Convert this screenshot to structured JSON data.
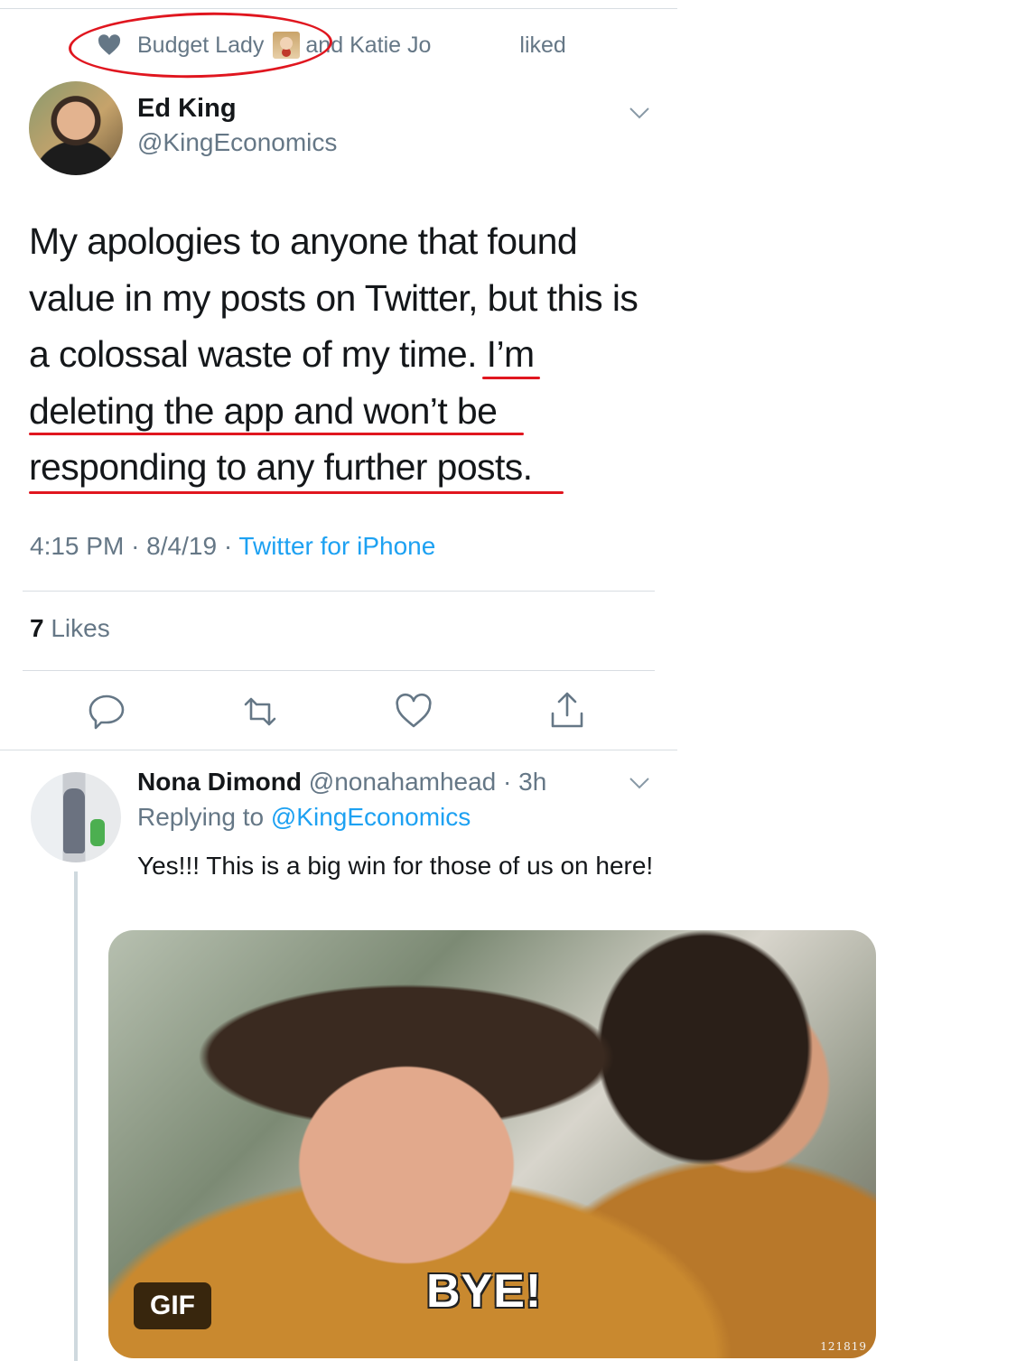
{
  "social_context": {
    "name_1": "Budget Lady",
    "connector": "and Katie Jo",
    "liked": "liked",
    "icon": "heart-icon"
  },
  "tweet": {
    "author_name": "Ed King",
    "author_handle": "@KingEconomics",
    "text_lines": [
      "My apologies to anyone that found",
      "value in my posts on Twitter, but this is",
      "a colossal waste of my time. I’m",
      "deleting the app and won’t be",
      "responding to any further posts."
    ],
    "time": "4:15 PM",
    "date": "8/4/19",
    "source": "Twitter for iPhone",
    "likes_count": "7",
    "likes_label": "Likes"
  },
  "actions": {
    "reply": "reply-icon",
    "retweet": "retweet-icon",
    "like": "like-icon",
    "share": "share-icon"
  },
  "reply": {
    "author_name": "Nona Dimond",
    "author_handle": "@nonahamhead",
    "time": "3h",
    "replying_prefix": "Replying to",
    "replying_to": "@KingEconomics",
    "text": "Yes!!! This is a big win for those of us on here!",
    "gif_badge": "GIF",
    "gif_caption": "BYE!",
    "gif_watermark": "121819"
  },
  "colors": {
    "annotation_red": "#e0161f",
    "link_blue": "#1da1f2",
    "secondary_gray": "#657786"
  }
}
